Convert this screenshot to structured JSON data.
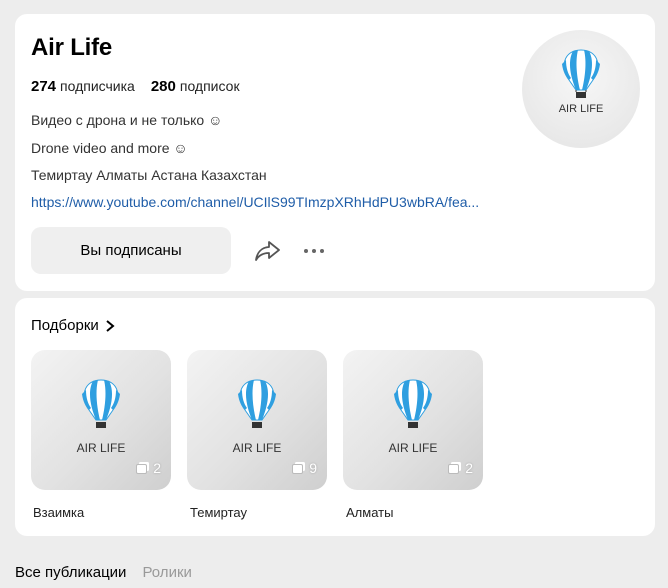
{
  "profile": {
    "name": "Air Life",
    "subscribers_count": "274",
    "subscribers_label": "подписчика",
    "subscriptions_count": "280",
    "subscriptions_label": "подписок",
    "description": [
      "Видео с дрона и не только ☺",
      "Drone video and more ☺",
      "Темиртау Алматы Астана Казахстан"
    ],
    "link": "https://www.youtube.com/channel/UCIlS99TImzpXRhHdPU3wbRA/fea...",
    "subscribed_label": "Вы подписаны",
    "logo_text": "AIR LIFE"
  },
  "collections": {
    "title": "Подборки",
    "items": [
      {
        "label": "Взаимка",
        "count": "2",
        "logo_text": "AIR LIFE"
      },
      {
        "label": "Темиртау",
        "count": "9",
        "logo_text": "AIR LIFE"
      },
      {
        "label": "Алматы",
        "count": "2",
        "logo_text": "AIR LIFE"
      }
    ]
  },
  "tabs": {
    "all_posts": "Все публикации",
    "videos": "Ролики"
  },
  "colors": {
    "balloon_blue": "#2f9fe0",
    "link_blue": "#1f5da8",
    "background": "#ededed"
  }
}
